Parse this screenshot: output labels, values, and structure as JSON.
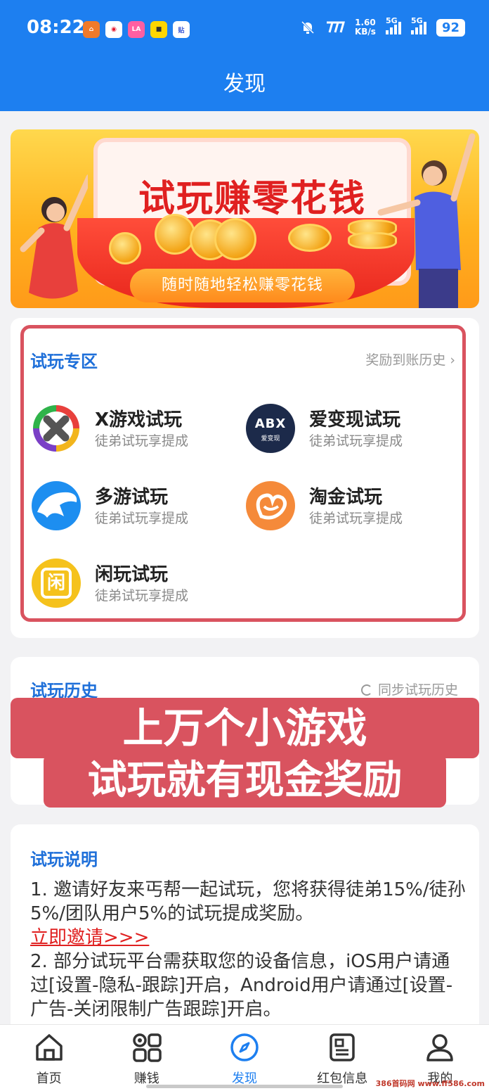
{
  "status_bar": {
    "time": "08:22",
    "net_speed": "1.60",
    "net_unit": "KB/s",
    "signal1_label": "5G",
    "signal2_label": "5G",
    "battery": "92",
    "app_icons": [
      "home-app-icon",
      "weibo-icon",
      "lala-icon",
      "app-icon-yellow",
      "tieba-icon"
    ]
  },
  "header": {
    "title": "发现"
  },
  "banner": {
    "headline": "试玩赚零花钱",
    "subtitle": "随时随地轻松赚零花钱"
  },
  "trial_zone": {
    "title": "试玩专区",
    "history_link": "奖励到账历史",
    "items": [
      {
        "name": "X游戏试玩",
        "desc": "徒弟试玩享提成",
        "icon": "x-game-icon"
      },
      {
        "name": "爱变现试玩",
        "desc": "徒弟试玩享提成",
        "icon": "abx-icon",
        "icon_text": "ABX",
        "icon_sub": "爱变现"
      },
      {
        "name": "多游试玩",
        "desc": "徒弟试玩享提成",
        "icon": "dolphin-icon"
      },
      {
        "name": "淘金试玩",
        "desc": "徒弟试玩享提成",
        "icon": "taojin-icon"
      },
      {
        "name": "闲玩试玩",
        "desc": "徒弟试玩享提成",
        "icon": "xianwan-icon",
        "icon_text": "闲"
      }
    ]
  },
  "trial_history": {
    "title": "试玩历史",
    "sync_label": "同步试玩历史",
    "overlay_line1": "上万个小游戏",
    "overlay_line2": "试玩就有现金奖励"
  },
  "trial_desc": {
    "title": "试玩说明",
    "p1": "1. 邀请好友来丐帮一起试玩，您将获得徒弟15%/徒孙5%/团队用户5%的试玩提成奖励。",
    "invite": "立即邀请>>>",
    "p2": "2. 部分试玩平台需获取您的设备信息，iOS用户请通过[设置-隐私-跟踪]开启，Android用户请通过[设置-广告-关闭限制广告跟踪]开启。"
  },
  "tabbar": {
    "tabs": [
      {
        "label": "首页",
        "icon": "home-icon"
      },
      {
        "label": "赚钱",
        "icon": "grid-icon"
      },
      {
        "label": "发现",
        "icon": "compass-icon",
        "active": true
      },
      {
        "label": "红包信息",
        "icon": "message-icon"
      },
      {
        "label": "我的",
        "icon": "user-icon"
      }
    ]
  },
  "watermark": "386首码网 www.ff586.com",
  "colors": {
    "primary": "#1d7ff0",
    "accent_red": "#d9535f",
    "link_red": "#e02020"
  }
}
